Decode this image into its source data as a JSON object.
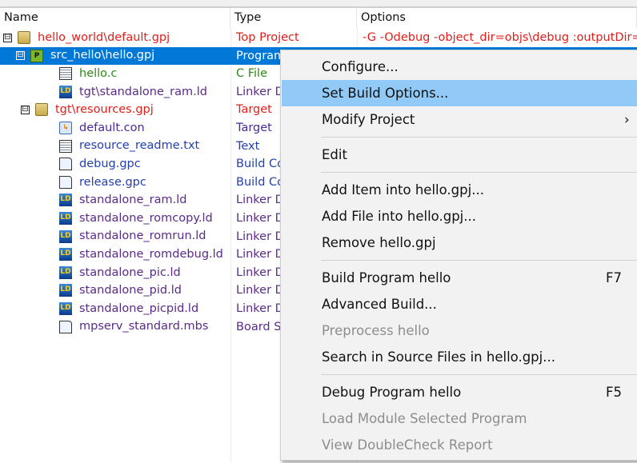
{
  "columns": {
    "name": "Name",
    "type": "Type",
    "options": "Options"
  },
  "rows": [
    {
      "name": "hello_world\\default.gpj",
      "type": "Top Project",
      "options": "-G -Odebug -object_dir=objs\\debug :outputDir=",
      "icon": "folder-icon",
      "color": "#e0201a",
      "expander": "⊟"
    },
    {
      "name": "src_hello\\hello.gpj",
      "type": "Program",
      "options": "",
      "icon": "program-icon",
      "color": "#ffffff",
      "expander": "⊟",
      "selected": true
    },
    {
      "name": "hello.c",
      "type": "C File",
      "icon": "c-file-icon",
      "color": "#2e8a18"
    },
    {
      "name": "tgt\\standalone_ram.ld",
      "type": "Linker D",
      "icon": "linker-icon",
      "color": "#5a2a8a"
    },
    {
      "name": "tgt\\resources.gpj",
      "type": "Target",
      "icon": "folder-icon",
      "color": "#e0201a",
      "expander": "⊟"
    },
    {
      "name": "default.con",
      "type": "Target",
      "icon": "connection-icon",
      "color": "#4a2a9a"
    },
    {
      "name": "resource_readme.txt",
      "type": "Text",
      "icon": "text-file-icon",
      "color": "#2440b0"
    },
    {
      "name": "debug.gpc",
      "type": "Build Co",
      "icon": "file-icon",
      "color": "#2440b0"
    },
    {
      "name": "release.gpc",
      "type": "Build Co",
      "icon": "file-icon",
      "color": "#2440b0"
    },
    {
      "name": "standalone_ram.ld",
      "type": "Linker D",
      "icon": "linker-icon",
      "color": "#5a2a8a"
    },
    {
      "name": "standalone_romcopy.ld",
      "type": "Linker D",
      "icon": "linker-icon",
      "color": "#5a2a8a"
    },
    {
      "name": "standalone_romrun.ld",
      "type": "Linker D",
      "icon": "linker-icon",
      "color": "#5a2a8a"
    },
    {
      "name": "standalone_romdebug.ld",
      "type": "Linker D",
      "icon": "linker-icon",
      "color": "#5a2a8a"
    },
    {
      "name": "standalone_pic.ld",
      "type": "Linker D",
      "icon": "linker-icon",
      "color": "#5a2a8a"
    },
    {
      "name": "standalone_pid.ld",
      "type": "Linker D",
      "icon": "linker-icon",
      "color": "#5a2a8a"
    },
    {
      "name": "standalone_picpid.ld",
      "type": "Linker D",
      "icon": "linker-icon",
      "color": "#5a2a8a"
    },
    {
      "name": "mpserv_standard.mbs",
      "type": "Board S",
      "icon": "file-icon",
      "color": "#5a2a8a"
    }
  ],
  "menu": [
    {
      "label": "Configure..."
    },
    {
      "label": "Set Build Options...",
      "highlighted": true
    },
    {
      "label": "Modify Project",
      "submenu": "›"
    },
    {
      "sep": true
    },
    {
      "label": "Edit"
    },
    {
      "sep": true
    },
    {
      "label": "Add Item into hello.gpj..."
    },
    {
      "label": "Add File into hello.gpj..."
    },
    {
      "label": "Remove hello.gpj"
    },
    {
      "sep": true
    },
    {
      "label": "Build Program hello",
      "shortcut": "F7"
    },
    {
      "label": "Advanced Build..."
    },
    {
      "label": "Preprocess hello",
      "disabled": true
    },
    {
      "label": "Search in Source Files in hello.gpj..."
    },
    {
      "sep": true
    },
    {
      "label": "Debug Program hello",
      "shortcut": "F5"
    },
    {
      "label": "Load Module Selected Program",
      "disabled": true
    },
    {
      "label": "View DoubleCheck Report",
      "disabled": true
    }
  ]
}
